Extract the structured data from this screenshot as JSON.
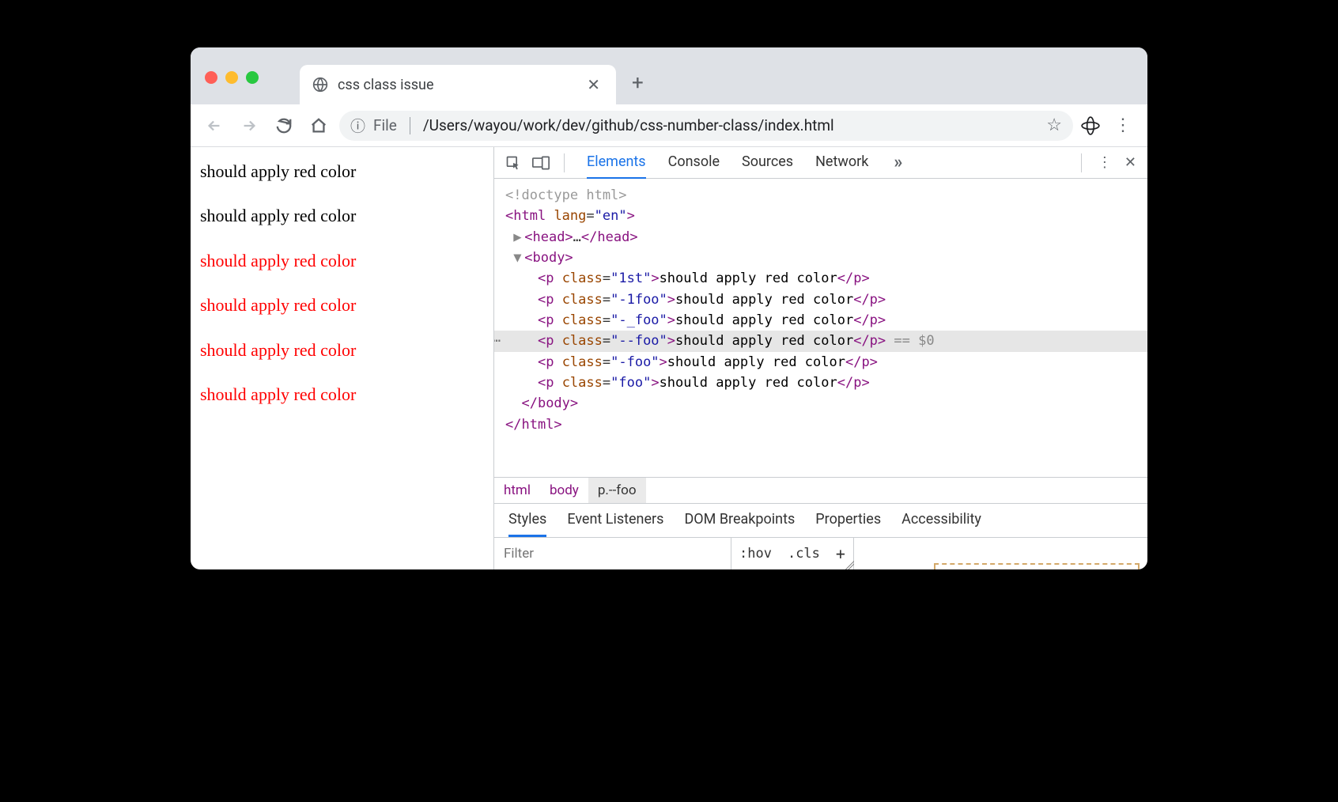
{
  "tab": {
    "title": "css class issue"
  },
  "omnibox": {
    "scheme": "File",
    "path": "/Users/wayou/work/dev/github/css-number-class/index.html"
  },
  "page_lines": [
    {
      "text": "should apply red color",
      "red": false
    },
    {
      "text": "should apply red color",
      "red": false
    },
    {
      "text": "should apply red color",
      "red": true
    },
    {
      "text": "should apply red color",
      "red": true
    },
    {
      "text": "should apply red color",
      "red": true
    },
    {
      "text": "should apply red color",
      "red": true
    }
  ],
  "devtools": {
    "tabs": [
      "Elements",
      "Console",
      "Sources",
      "Network"
    ],
    "active_tab": "Elements",
    "dom": {
      "doctype": "<!doctype html>",
      "html_open": "<html lang=\"en\">",
      "head": "<head>…</head>",
      "body_open": "<body>",
      "p_items": [
        {
          "class": "1st",
          "text": "should apply red color",
          "selected": false
        },
        {
          "class": "-1foo",
          "text": "should apply red color",
          "selected": false
        },
        {
          "class": "-_foo",
          "text": "should apply red color",
          "selected": false
        },
        {
          "class": "--foo",
          "text": "should apply red color",
          "selected": true,
          "suffix": " == $0"
        },
        {
          "class": "-foo",
          "text": "should apply red color",
          "selected": false
        },
        {
          "class": "foo",
          "text": "should apply red color",
          "selected": false
        }
      ],
      "body_close": "</body>",
      "html_close": "</html>"
    },
    "breadcrumb": [
      "html",
      "body",
      "p.--foo"
    ],
    "styles_tabs": [
      "Styles",
      "Event Listeners",
      "DOM Breakpoints",
      "Properties",
      "Accessibility"
    ],
    "styles_active": "Styles",
    "filter_placeholder": "Filter",
    "hov_label": ":hov",
    "cls_label": ".cls"
  }
}
